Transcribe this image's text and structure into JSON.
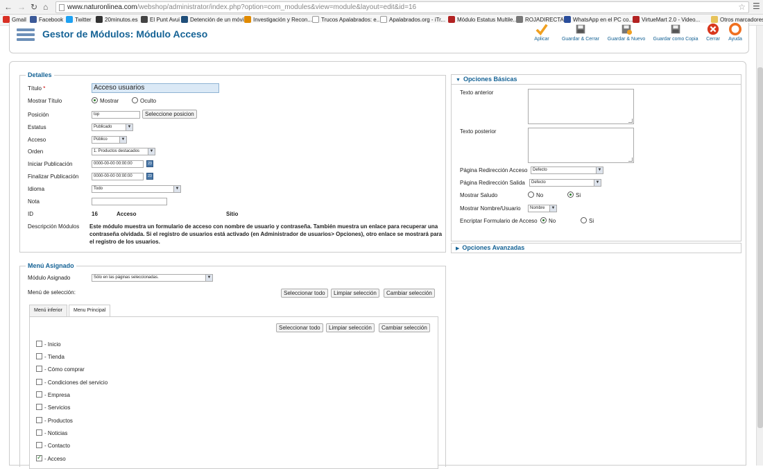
{
  "browser": {
    "url_host": "www.naturonlinea.com",
    "url_path": "/webshop/administrator/index.php?option=com_modules&view=module&layout=edit&id=16",
    "bookmarks": [
      "Gmail",
      "Facebook",
      "Twitter",
      "20minutos.es",
      "El Punt Avui",
      "Detención de un móvil",
      "Investigación y Recon...",
      "Trucos Apalabrados: e...",
      "Apalabrados.org - iTr...",
      "Módulo Estatus Multile...",
      "ROJADIRECTA",
      "WhatsApp en el PC co...",
      "VirtueMart 2.0 - Video...",
      "Otros marcadores"
    ]
  },
  "header": {
    "title": "Gestor de Módulos: Módulo Acceso",
    "toolbar": {
      "apply": "Aplicar",
      "save_close": "Guardar & Cerrar",
      "save_new": "Guardar & Nuevo",
      "save_copy": "Guardar como Copia",
      "close": "Cerrar",
      "help": "Ayuda"
    }
  },
  "details": {
    "legend": "Detalles",
    "title_label": "Título",
    "required_mark": "*",
    "title_value": "Acceso usuarios",
    "show_title_label": "Mostrar Título",
    "show_option": "Mostrar",
    "hide_option": "Oculto",
    "position_label": "Posición",
    "position_value": "top",
    "position_button": "Seleccione posicion",
    "status_label": "Estatus",
    "status_value": "Publicado",
    "access_label": "Acceso",
    "access_value": "Público",
    "order_label": "Orden",
    "order_value": "1. Productos destacados",
    "start_label": "Iniciar Publicación",
    "start_value": "0000-00-00 00:00:00",
    "finish_label": "Finalizar Publicación",
    "finish_value": "0000-00-00 00:00:00",
    "cal_icon": "23",
    "language_label": "Idioma",
    "language_value": "Todo",
    "note_label": "Nota",
    "note_value": "",
    "id_label": "ID",
    "id_value": "16",
    "id_module": "Acceso",
    "id_site": "Sitio",
    "desc_label": "Descripción Módulos",
    "desc_line1": "Este módulo muestra un formulario de acceso con nombre de usuario y contraseña. También muestra un enlace para recuperar una",
    "desc_line2": "contraseña olvidada. Si el registro de usuarios está activado (en Administrador de usuarios> Opciones), otro enlace se mostrará para",
    "desc_line3": "el registro de los usuarios."
  },
  "basic": {
    "header": "Opciones Básicas",
    "pretext_label": "Texto anterior",
    "posttext_label": "Texto posterior",
    "login_redirect_label": "Página Redirección Acceso",
    "login_redirect_value": "Defecto",
    "logout_redirect_label": "Página Redirección Salida",
    "logout_redirect_value": "Defecto",
    "greeting_label": "Mostrar Saludo",
    "greeting_no": "No",
    "greeting_yes": "Si",
    "name_label": "Mostrar Nombre/Usuario",
    "name_value": "Nombre",
    "encrypt_label": "Encriptar Formulario de Acceso",
    "encrypt_no": "No",
    "encrypt_yes": "Si"
  },
  "advanced": {
    "header": "Opciones Avanzadas"
  },
  "menu_assignment": {
    "legend": "Menú Asignado",
    "module_label": "Módulo Asignado",
    "module_value": "Sólo en las páginas seleccionadas.",
    "selection_label": "Menú de selección:",
    "select_all": "Seleccionar todo",
    "clear_selection": "Limpiar selección",
    "toggle_selection": "Cambiar selección",
    "tabs": [
      "Menú inferior",
      "Menu Principal"
    ],
    "items": [
      {
        "label": "- Inicio",
        "checked": false
      },
      {
        "label": "- Tienda",
        "checked": false
      },
      {
        "label": "- Cómo comprar",
        "checked": false
      },
      {
        "label": "- Condiciones del servicio",
        "checked": false
      },
      {
        "label": "- Empresa",
        "checked": false
      },
      {
        "label": "- Servicios",
        "checked": false
      },
      {
        "label": "- Productos",
        "checked": false
      },
      {
        "label": "- Noticias",
        "checked": false
      },
      {
        "label": "- Contacto",
        "checked": false
      },
      {
        "label": "- Acceso",
        "checked": true
      }
    ]
  },
  "colors": {
    "accent": "#146295",
    "title_input_bg": "#dbe9f6",
    "radio_on": "#2a7d2a"
  }
}
